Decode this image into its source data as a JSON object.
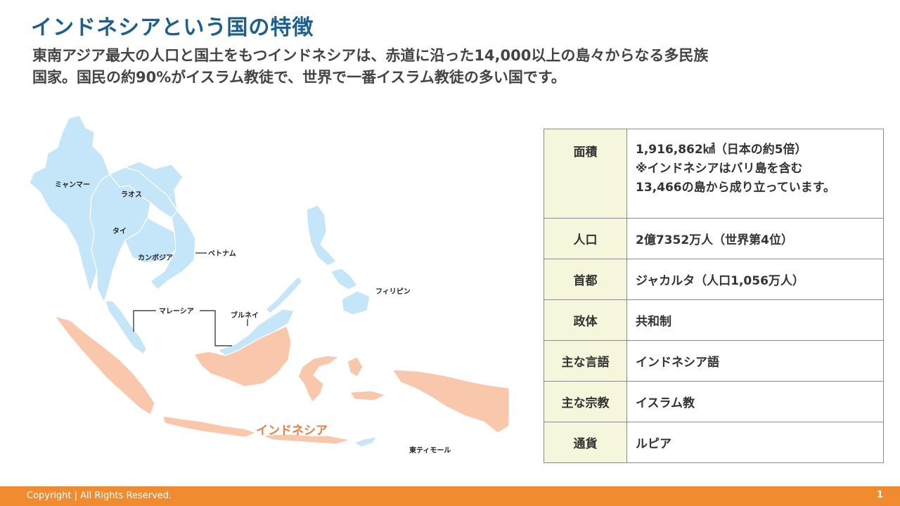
{
  "slide": {
    "title": "インドネシアという国の特徴",
    "lead_line1": "東南アジア最大の人口と国土をもつインドネシアは、赤道に沿った14,000以上の島々からなる多民族",
    "lead_line2": "国家。国民の約90%がイスラム教徒で、世界で一番イスラム教徒の多い国です。"
  },
  "map": {
    "labels": {
      "myanmar": "ミャンマー",
      "laos": "ラオス",
      "thailand": "タイ",
      "cambodia": "カンボジア",
      "vietnam": "ベトナム",
      "philippines": "フィリピン",
      "malaysia": "マレーシア",
      "brunei": "ブルネイ",
      "indonesia": "インドネシア",
      "east_timor": "東ティモール"
    },
    "colors": {
      "neighbor": "#c4e6f8",
      "indonesia": "#f9c7ac",
      "indonesia_label": "#e97f45"
    }
  },
  "table": {
    "rows": [
      {
        "key": "面積",
        "lines": [
          "1,916,862㎢（日本の約5倍）",
          "※インドネシアはバリ島を含む",
          "13,466の島から成り立っています。"
        ]
      },
      {
        "key": "人口",
        "lines": [
          "2億7352万人（世界第4位）"
        ]
      },
      {
        "key": "首都",
        "lines": [
          "ジャカルタ（人口1,056万人）"
        ]
      },
      {
        "key": "政体",
        "lines": [
          "共和制"
        ]
      },
      {
        "key": "主な言語",
        "lines": [
          "インドネシア語"
        ]
      },
      {
        "key": "主な宗教",
        "lines": [
          "イスラム教"
        ]
      },
      {
        "key": "通貨",
        "lines": [
          "ルピア"
        ]
      }
    ]
  },
  "footer": {
    "copyright": "Copyright | All Rights Reserved.",
    "page": "1"
  }
}
